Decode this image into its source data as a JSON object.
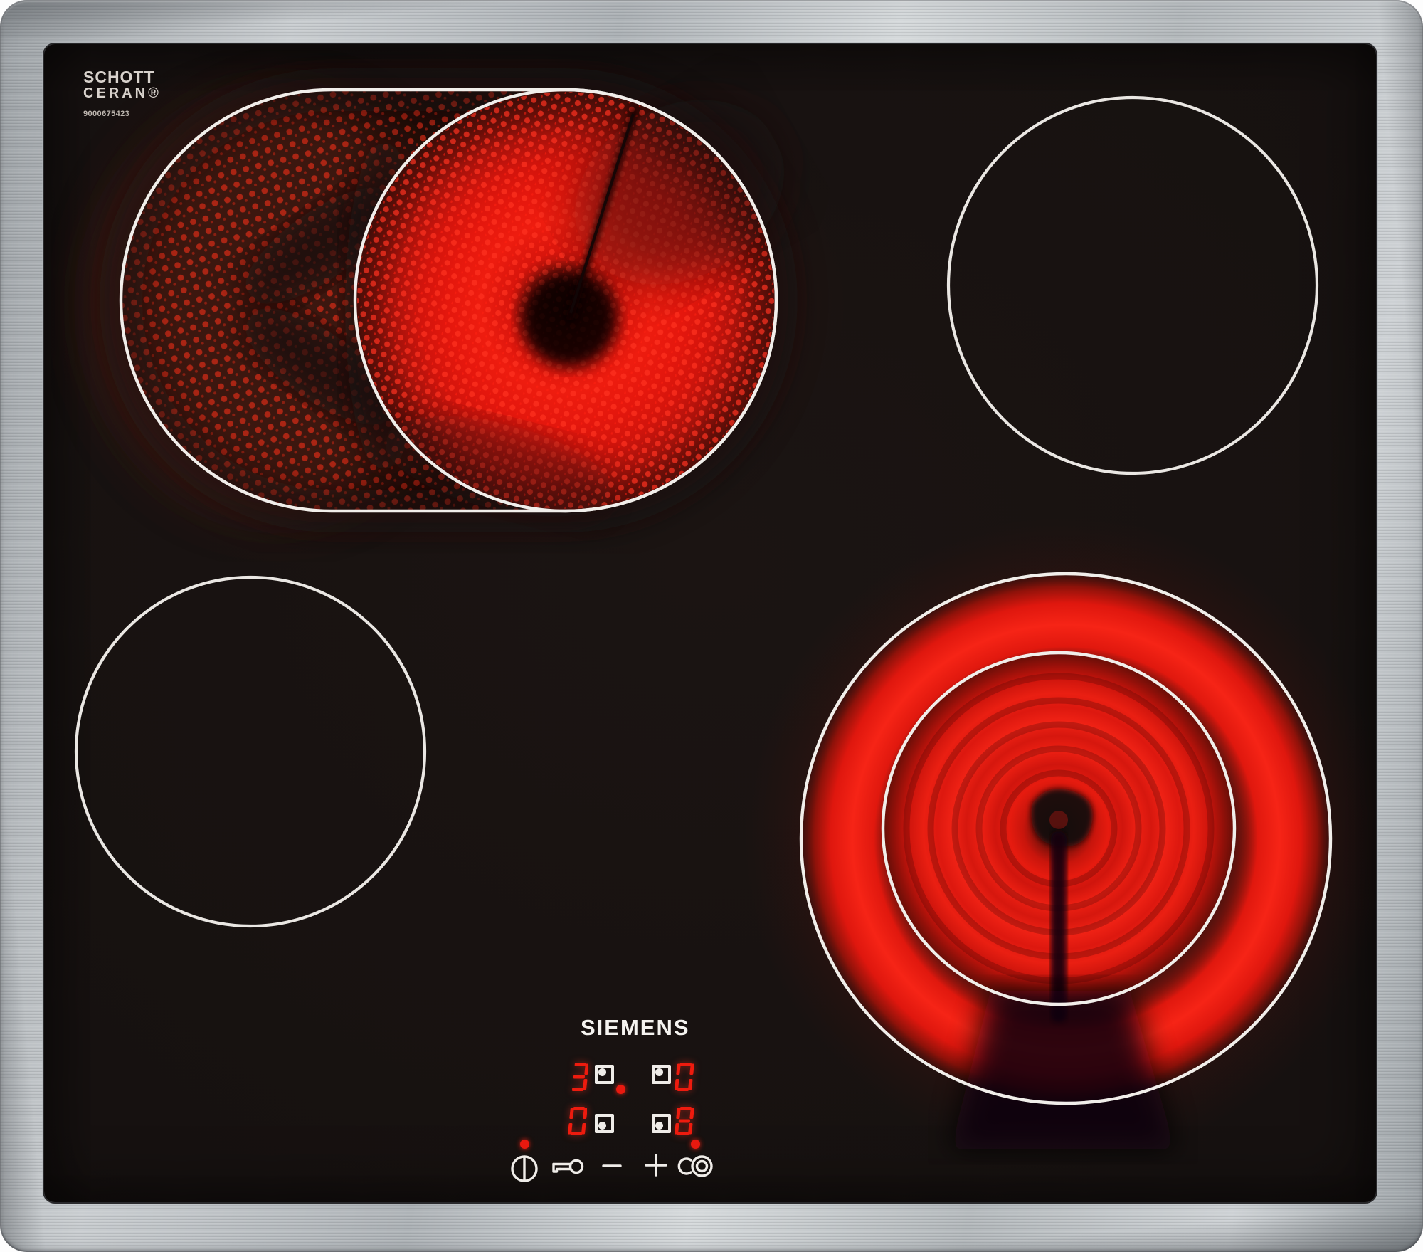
{
  "branding": {
    "glass_maker_line1": "SCHOTT",
    "glass_maker_line2": "CERAN®",
    "model_number": "9000675423",
    "manufacturer": "SIEMENS"
  },
  "control_panel": {
    "displays": [
      {
        "zone": "rear-left",
        "value": "3",
        "square_dot": "top-left",
        "red_decimal_dot": true
      },
      {
        "zone": "rear-right",
        "value": "0",
        "square_dot": "top-left",
        "red_decimal_dot": false
      },
      {
        "zone": "front-left",
        "value": "0",
        "square_dot": "bottom-left",
        "red_decimal_dot": false
      },
      {
        "zone": "front-right",
        "value": "8",
        "square_dot": "bottom-left",
        "red_decimal_dot": false
      }
    ],
    "buttons": [
      {
        "id": "power",
        "icon": "power-icon",
        "indicator_dot_on": true
      },
      {
        "id": "child-lock",
        "icon": "key-icon",
        "indicator_dot_on": false
      },
      {
        "id": "minus",
        "icon": "minus-icon",
        "indicator_dot_on": false
      },
      {
        "id": "plus",
        "icon": "plus-icon",
        "indicator_dot_on": false
      },
      {
        "id": "dual-zone",
        "icon": "dual-zone-icon",
        "indicator_dot_on": true
      }
    ]
  },
  "zones": [
    {
      "position": "rear-left",
      "type": "dual-extendable-roaster",
      "state": "on",
      "heat_level": "3"
    },
    {
      "position": "rear-right",
      "type": "single",
      "state": "off",
      "heat_level": "0"
    },
    {
      "position": "front-left",
      "type": "single",
      "state": "off",
      "heat_level": "0"
    },
    {
      "position": "front-right",
      "type": "dual-ring",
      "state": "on",
      "heat_level": "8"
    }
  ],
  "colors": {
    "glass": "#161110",
    "frame_metal": "#b9bdc0",
    "element_glow": "#f01d10",
    "indicator_red": "#e8190f",
    "zone_outline_white": "#f0ede9"
  }
}
